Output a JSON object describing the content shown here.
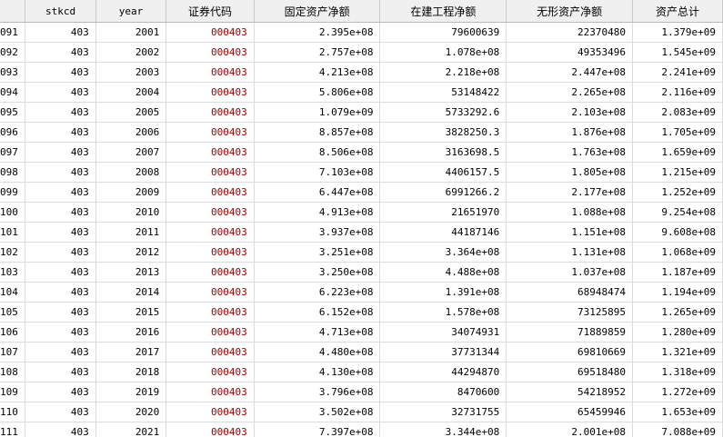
{
  "columns": [
    "",
    "stkcd",
    "year",
    "证券代码",
    "固定资产净额",
    "在建工程净额",
    "无形资产净额",
    "资产总计"
  ],
  "rows": [
    [
      "091",
      "403",
      "2001",
      "000403",
      "2.395e+08",
      "79600639",
      "22370480",
      "1.379e+09"
    ],
    [
      "092",
      "403",
      "2002",
      "000403",
      "2.757e+08",
      "1.078e+08",
      "49353496",
      "1.545e+09"
    ],
    [
      "093",
      "403",
      "2003",
      "000403",
      "4.213e+08",
      "2.218e+08",
      "2.447e+08",
      "2.241e+09"
    ],
    [
      "094",
      "403",
      "2004",
      "000403",
      "5.806e+08",
      "53148422",
      "2.265e+08",
      "2.116e+09"
    ],
    [
      "095",
      "403",
      "2005",
      "000403",
      "1.079e+09",
      "5733292.6",
      "2.103e+08",
      "2.083e+09"
    ],
    [
      "096",
      "403",
      "2006",
      "000403",
      "8.857e+08",
      "3828250.3",
      "1.876e+08",
      "1.705e+09"
    ],
    [
      "097",
      "403",
      "2007",
      "000403",
      "8.506e+08",
      "3163698.5",
      "1.763e+08",
      "1.659e+09"
    ],
    [
      "098",
      "403",
      "2008",
      "000403",
      "7.103e+08",
      "4406157.5",
      "1.805e+08",
      "1.215e+09"
    ],
    [
      "099",
      "403",
      "2009",
      "000403",
      "6.447e+08",
      "6991266.2",
      "2.177e+08",
      "1.252e+09"
    ],
    [
      "100",
      "403",
      "2010",
      "000403",
      "4.913e+08",
      "21651970",
      "1.088e+08",
      "9.254e+08"
    ],
    [
      "101",
      "403",
      "2011",
      "000403",
      "3.937e+08",
      "44187146",
      "1.151e+08",
      "9.608e+08"
    ],
    [
      "102",
      "403",
      "2012",
      "000403",
      "3.251e+08",
      "3.364e+08",
      "1.131e+08",
      "1.068e+09"
    ],
    [
      "103",
      "403",
      "2013",
      "000403",
      "3.250e+08",
      "4.488e+08",
      "1.037e+08",
      "1.187e+09"
    ],
    [
      "104",
      "403",
      "2014",
      "000403",
      "6.223e+08",
      "1.391e+08",
      "68948474",
      "1.194e+09"
    ],
    [
      "105",
      "403",
      "2015",
      "000403",
      "6.152e+08",
      "1.578e+08",
      "73125895",
      "1.265e+09"
    ],
    [
      "106",
      "403",
      "2016",
      "000403",
      "4.713e+08",
      "34074931",
      "71889859",
      "1.280e+09"
    ],
    [
      "107",
      "403",
      "2017",
      "000403",
      "4.480e+08",
      "37731344",
      "69810669",
      "1.321e+09"
    ],
    [
      "108",
      "403",
      "2018",
      "000403",
      "4.130e+08",
      "44294870",
      "69518480",
      "1.318e+09"
    ],
    [
      "109",
      "403",
      "2019",
      "000403",
      "3.796e+08",
      "8470600",
      "54218952",
      "1.272e+09"
    ],
    [
      "110",
      "403",
      "2020",
      "000403",
      "3.502e+08",
      "32731755",
      "65459946",
      "1.653e+09"
    ],
    [
      "111",
      "403",
      "2021",
      "000403",
      "7.397e+08",
      "3.344e+08",
      "2.001e+08",
      "7.088e+09"
    ]
  ],
  "colors": {
    "code_text": "#a00000",
    "header_bg": "#f0f0f0",
    "grid_line": "#dcdcdc"
  }
}
